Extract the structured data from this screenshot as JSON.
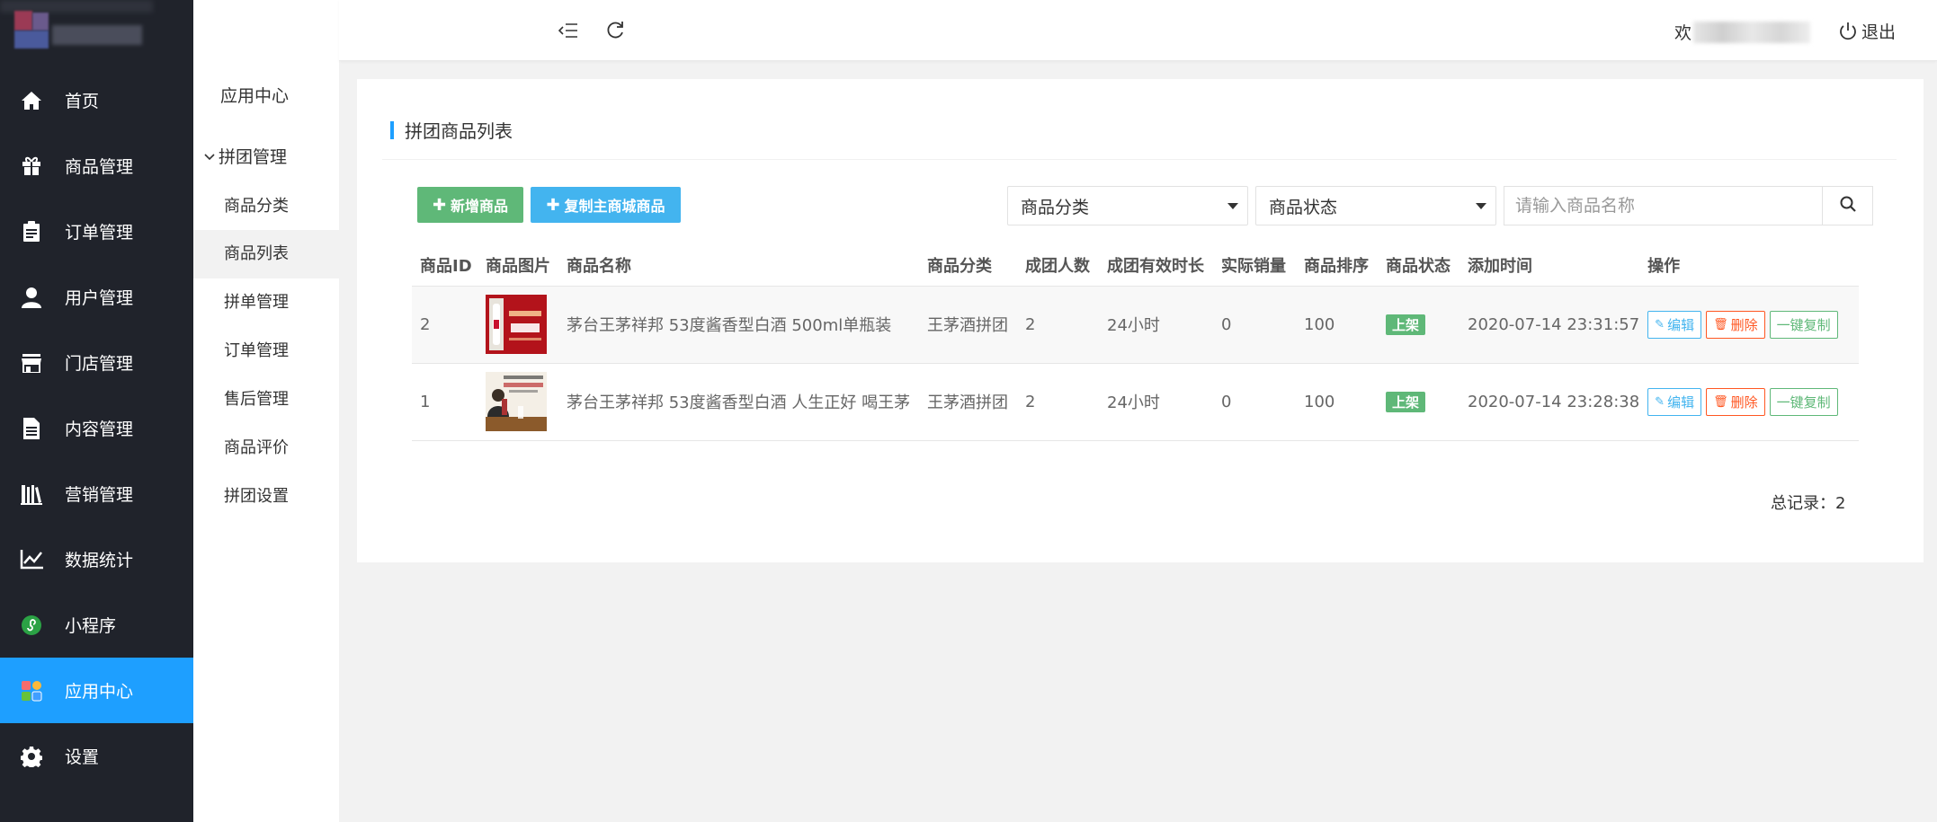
{
  "sidebar": {
    "items": [
      {
        "label": "首页",
        "icon": "home-icon"
      },
      {
        "label": "商品管理",
        "icon": "gift-icon"
      },
      {
        "label": "订单管理",
        "icon": "clipboard-icon"
      },
      {
        "label": "用户管理",
        "icon": "user-icon"
      },
      {
        "label": "门店管理",
        "icon": "store-icon"
      },
      {
        "label": "内容管理",
        "icon": "document-icon"
      },
      {
        "label": "营销管理",
        "icon": "books-icon"
      },
      {
        "label": "数据统计",
        "icon": "line-chart-icon"
      },
      {
        "label": "小程序",
        "icon": "mini-program-icon"
      },
      {
        "label": "应用中心",
        "icon": "apps-icon"
      },
      {
        "label": "设置",
        "icon": "gear-icon"
      }
    ],
    "active_index": 9
  },
  "subnav": {
    "title": "应用中心",
    "group": "拼团管理",
    "items": [
      "商品分类",
      "商品列表",
      "拼单管理",
      "订单管理",
      "售后管理",
      "商品评价",
      "拼团设置"
    ],
    "active_index": 1
  },
  "header": {
    "welcome_prefix": "欢",
    "logout_label": "退出"
  },
  "card": {
    "title": "拼团商品列表",
    "add_button": "新增商品",
    "copy_button": "复制主商城商品",
    "category_select": "商品分类",
    "status_select": "商品状态",
    "search_placeholder": "请输入商品名称",
    "total_label": "总记录：2"
  },
  "table": {
    "headers": [
      "商品ID",
      "商品图片",
      "商品名称",
      "商品分类",
      "成团人数",
      "成团有效时长",
      "实际销量",
      "商品排序",
      "商品状态",
      "添加时间",
      "操作"
    ],
    "rows": [
      {
        "id": "2",
        "name": "茅台王茅祥邦 53度酱香型白酒 500ml单瓶装",
        "category": "王茅酒拼团",
        "group_size": "2",
        "duration": "24小时",
        "sales": "0",
        "sort": "100",
        "status": "上架",
        "time": "2020-07-14 23:31:57"
      },
      {
        "id": "1",
        "name": "茅台王茅祥邦 53度酱香型白酒 人生正好 喝王茅",
        "category": "王茅酒拼团",
        "group_size": "2",
        "duration": "24小时",
        "sales": "0",
        "sort": "100",
        "status": "上架",
        "time": "2020-07-14 23:28:38"
      }
    ],
    "ops": {
      "edit": "编辑",
      "delete": "删除",
      "copy": "一键复制"
    }
  },
  "colors": {
    "sidebar_bg": "#20232b",
    "accent": "#1e9fff",
    "green": "#5fb878",
    "danger": "#ff5722"
  }
}
